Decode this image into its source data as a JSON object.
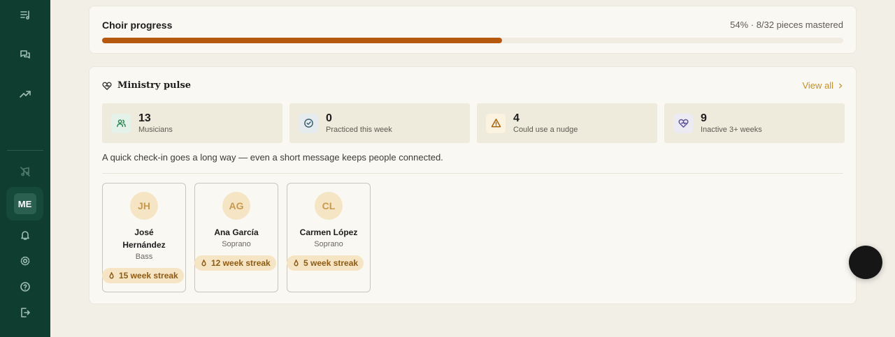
{
  "sidebar": {
    "nav_icons": [
      "music-list-icon",
      "messages-icon",
      "trending-icon"
    ],
    "muted_icon": "muted-music-icon",
    "user_initials": "ME",
    "bottom_icons": [
      "bell-icon",
      "gear-icon",
      "help-icon",
      "logout-icon"
    ]
  },
  "progress": {
    "title": "Choir progress",
    "summary": "54% · 8/32 pieces mastered",
    "percent": 54,
    "color": "#b5590f"
  },
  "pulse": {
    "title": "Ministry pulse",
    "view_all": "View all",
    "note": "A quick check-in goes a long way — even a short message keeps people connected.",
    "stats": [
      {
        "value": "13",
        "label": "Musicians",
        "icon": "users-icon"
      },
      {
        "value": "0",
        "label": "Practiced this week",
        "icon": "check-circle-icon"
      },
      {
        "value": "4",
        "label": "Could use a nudge",
        "icon": "warning-icon"
      },
      {
        "value": "9",
        "label": "Inactive 3+ weeks",
        "icon": "heart-icon"
      }
    ],
    "members": [
      {
        "initials": "JH",
        "name": "José Hernández",
        "part": "Bass",
        "streak": "15 week streak"
      },
      {
        "initials": "AG",
        "name": "Ana García",
        "part": "Soprano",
        "streak": "12 week streak"
      },
      {
        "initials": "CL",
        "name": "Carmen López",
        "part": "Soprano",
        "streak": "5 week streak"
      }
    ]
  }
}
